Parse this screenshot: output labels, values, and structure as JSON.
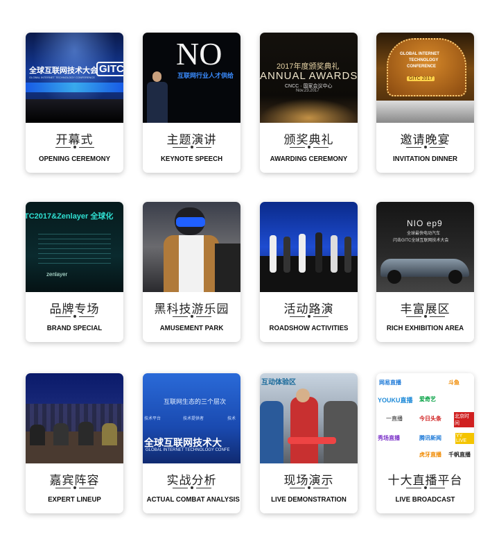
{
  "cards": [
    {
      "cn": "开幕式",
      "en": "OPENING CEREMONY",
      "photo_text": [
        "全球互联网技术大会",
        "GLOBAL INTERNET TECHNOLOGY CONFERENCE",
        "GITC"
      ]
    },
    {
      "cn": "主题演讲",
      "en": "KEYNOTE SPEECH",
      "photo_text": [
        "NO",
        "互联网行业人才供给"
      ]
    },
    {
      "cn": "颁奖典礼",
      "en": "AWARDING CEREMONY",
      "photo_text": [
        "2017年度颁奖典礼",
        "ANNUAL AWARDS",
        "CNCC · 国家会议中心",
        "Nov.23.2017"
      ]
    },
    {
      "cn": "邀请晚宴",
      "en": "INVITATION DINNER",
      "photo_text": [
        "GLOBAL INTERNET",
        "TECHNOLOGY",
        "CONFERENCE",
        "GITC 2017"
      ]
    },
    {
      "cn": "品牌专场",
      "en": "BRAND SPECIAL",
      "photo_text": [
        "TC2017&Zenlayer 全球化",
        "zenlayer"
      ]
    },
    {
      "cn": "黑科技游乐园",
      "en": "AMUSEMENT PARK",
      "photo_text": []
    },
    {
      "cn": "活动路演",
      "en": "ROADSHOW ACTIVITIES",
      "photo_text": []
    },
    {
      "cn": "丰富展区",
      "en": "RICH EXHIBITION AREA",
      "photo_text": [
        "NIO ep9",
        "全球最快电动汽车",
        "闪击GITC全球互联网技术大会"
      ]
    },
    {
      "cn": "嘉宾阵容",
      "en": "EXPERT LINEUP",
      "photo_text": []
    },
    {
      "cn": "实战分析",
      "en": "ACTUAL COMBAT ANALYSIS",
      "photo_text": [
        "互联网生态的三个层次",
        "技术平台",
        "技术提供者",
        "技术",
        "全球互联网技术大",
        "GLOBAL INTERNET TECHNOLOGY CONFE"
      ]
    },
    {
      "cn": "现场演示",
      "en": "LIVE DEMONSTRATION",
      "photo_text": [
        "互动体验区"
      ]
    },
    {
      "cn": "十大直播平台",
      "en": "LIVE BROADCAST",
      "photo_text": [
        "网易直播",
        "斗鱼",
        "YOUKU直播",
        "爱奇艺",
        "一直播",
        "今日头条",
        "北京时间",
        "秀场直播",
        "腾讯新闻",
        "YY LIVE",
        "虎牙直播",
        "千帆直播"
      ]
    }
  ],
  "colors": {
    "text": "#222222",
    "card_bg": "#ffffff"
  }
}
